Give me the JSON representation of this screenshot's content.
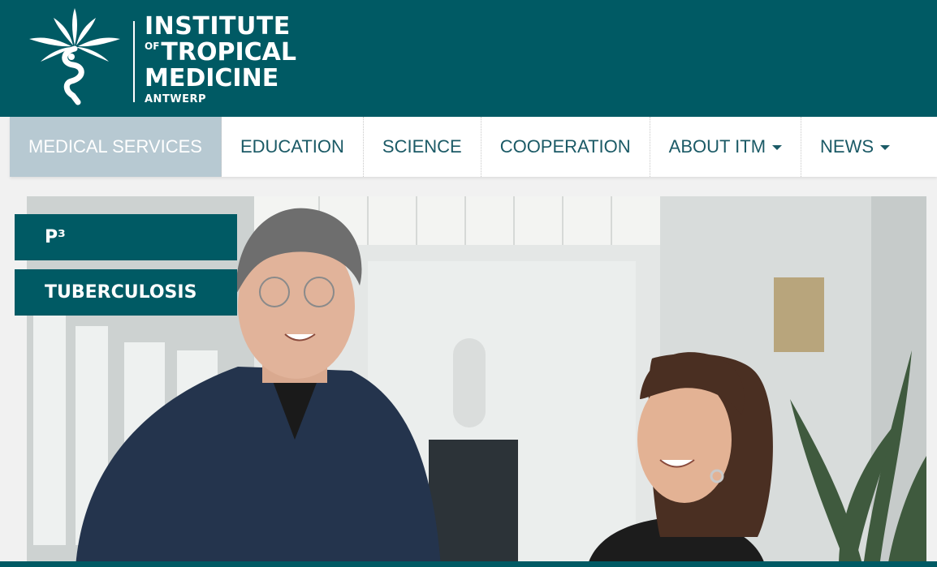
{
  "brand": {
    "line1": "INSTITUTE",
    "line2_prefix": "OF",
    "line2": "TROPICAL",
    "line3": "MEDICINE",
    "line4": "ANTWERP",
    "color": "#005a64"
  },
  "nav": {
    "items": [
      {
        "label": "MEDICAL SERVICES",
        "active": true,
        "dropdown": false
      },
      {
        "label": "EDUCATION",
        "active": false,
        "dropdown": false
      },
      {
        "label": "SCIENCE",
        "active": false,
        "dropdown": false
      },
      {
        "label": "COOPERATION",
        "active": false,
        "dropdown": false
      },
      {
        "label": "ABOUT ITM",
        "active": false,
        "dropdown": true
      },
      {
        "label": "NEWS",
        "active": false,
        "dropdown": true
      }
    ]
  },
  "sidebar_buttons": [
    {
      "label": "P³"
    },
    {
      "label": "TUBERCULOSIS"
    }
  ],
  "hero": {
    "icon": "hero-photo-two-researchers"
  }
}
